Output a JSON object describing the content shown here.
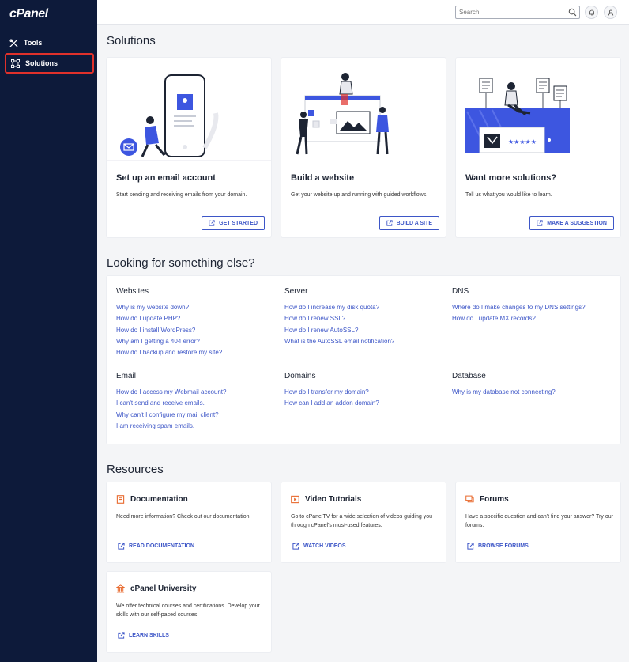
{
  "brand": {
    "logo": "cPanel"
  },
  "sidebar": {
    "items": [
      {
        "label": "Tools",
        "icon": "tools-icon"
      },
      {
        "label": "Solutions",
        "icon": "solutions-icon",
        "active": true
      }
    ]
  },
  "topbar": {
    "search_placeholder": "Search"
  },
  "solutions": {
    "heading": "Solutions",
    "cards": [
      {
        "title": "Set up an email account",
        "desc": "Start sending and receiving emails from your domain.",
        "button": "GET STARTED"
      },
      {
        "title": "Build a website",
        "desc": "Get your website up and running with guided workflows.",
        "button": "BUILD A SITE"
      },
      {
        "title": "Want more solutions?",
        "desc": "Tell us what you would like to learn.",
        "button": "MAKE A SUGGESTION"
      }
    ]
  },
  "faq": {
    "heading": "Looking for something else?",
    "groups": [
      {
        "title": "Websites",
        "links": [
          "Why is my website down?",
          "How do I update PHP?",
          "How do I install WordPress?",
          "Why am I getting a 404 error?",
          "How do I backup and restore my site?"
        ]
      },
      {
        "title": "Server",
        "links": [
          "How do I increase my disk quota?",
          "How do I renew SSL?",
          "How do I renew AutoSSL?",
          "What is the AutoSSL email notification?"
        ]
      },
      {
        "title": "DNS",
        "links": [
          "Where do I make changes to my DNS settings?",
          "How do I update MX records?"
        ]
      },
      {
        "title": "Email",
        "links": [
          "How do I access my Webmail account?",
          "I can't send and receive emails.",
          "Why can't I configure my mail client?",
          "I am receiving spam emails."
        ]
      },
      {
        "title": "Domains",
        "links": [
          "How do I transfer my domain?",
          "How can I add an addon domain?"
        ]
      },
      {
        "title": "Database",
        "links": [
          "Why is my database not connecting?"
        ]
      }
    ]
  },
  "resources": {
    "heading": "Resources",
    "accent": "#e8692d",
    "cards": [
      {
        "title": "Documentation",
        "icon": "document-icon",
        "desc": "Need more information? Check out our documentation.",
        "link": "READ DOCUMENTATION"
      },
      {
        "title": "Video Tutorials",
        "icon": "video-icon",
        "desc": "Go to cPanelTV for a wide selection of videos guiding you through cPanel's most-used features.",
        "link": "WATCH VIDEOS"
      },
      {
        "title": "Forums",
        "icon": "forum-icon",
        "desc": "Have a specific question and can't find your answer? Try our forums.",
        "link": "BROWSE FORUMS"
      },
      {
        "title": "cPanel University",
        "icon": "university-icon",
        "desc": "We offer technical courses and certifications. Develop your skills with our self-paced courses.",
        "link": "LEARN SKILLS"
      }
    ]
  },
  "colors": {
    "sidebar": "#0d1a3a",
    "link": "#3d56c7",
    "highlight": "#e0312b",
    "illustration": "#3d56e0"
  }
}
